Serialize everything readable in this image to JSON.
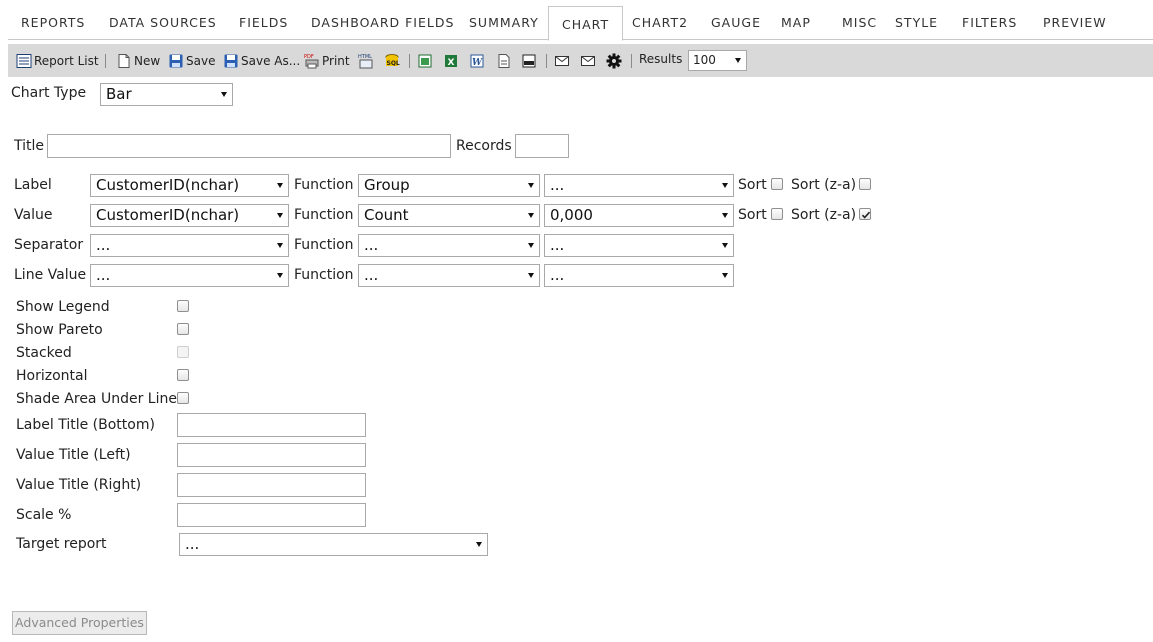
{
  "tabs": [
    {
      "label": "REPORTS"
    },
    {
      "label": "DATA SOURCES"
    },
    {
      "label": "FIELDS"
    },
    {
      "label": "DASHBOARD FIELDS"
    },
    {
      "label": "SUMMARY"
    },
    {
      "label": "CHART",
      "active": true
    },
    {
      "label": "CHART2"
    },
    {
      "label": "GAUGE"
    },
    {
      "label": "MAP"
    },
    {
      "label": "MISC"
    },
    {
      "label": "STYLE"
    },
    {
      "label": "FILTERS"
    },
    {
      "label": "PREVIEW"
    }
  ],
  "toolbar": {
    "report_list": "Report List",
    "new": "New",
    "save": "Save",
    "save_as": "Save As...",
    "print": "Print",
    "results_label": "Results",
    "results_value": "100"
  },
  "chart_type": {
    "label": "Chart Type",
    "value": "Bar"
  },
  "title_field": {
    "label": "Title",
    "value": ""
  },
  "records": {
    "label": "Records",
    "value": ""
  },
  "rows": [
    {
      "label": "Label",
      "field": "CustomerID(nchar)",
      "function_label": "Function",
      "function": "Group",
      "format": "...",
      "sort_label": "Sort",
      "sort_za_label": "Sort (z-a)",
      "sort_checked": false,
      "sort_za_checked": false
    },
    {
      "label": "Value",
      "field": "CustomerID(nchar)",
      "function_label": "Function",
      "function": "Count",
      "format": "0,000",
      "sort_label": "Sort",
      "sort_za_label": "Sort (z-a)",
      "sort_checked": false,
      "sort_za_checked": true
    },
    {
      "label": "Separator",
      "field": "...",
      "function_label": "Function",
      "function": "...",
      "format": "..."
    },
    {
      "label": "Line Value",
      "field": "...",
      "function_label": "Function",
      "function": "...",
      "format": "..."
    }
  ],
  "options": {
    "show_legend": "Show Legend",
    "show_pareto": "Show Pareto",
    "stacked": "Stacked",
    "horizontal": "Horizontal",
    "shade_area": "Shade Area Under Line"
  },
  "titles": {
    "label_bottom": "Label Title (Bottom)",
    "value_left": "Value Title (Left)",
    "value_right": "Value Title (Right)",
    "scale": "Scale %",
    "target_report": "Target report",
    "target_report_value": "..."
  },
  "advanced_button": "Advanced Properties"
}
